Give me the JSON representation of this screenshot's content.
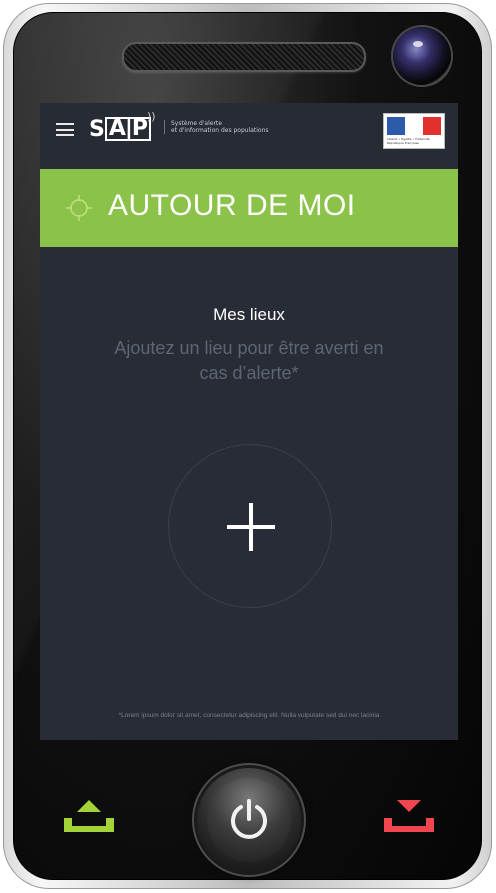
{
  "header": {
    "logo_text": "SAIP",
    "tagline_line1": "Système d'alerte",
    "tagline_line2": "et d'information des populations",
    "flag_caption": "Liberté • Égalité • Fraternité  République Française"
  },
  "banner": {
    "title": "AUTOUR DE MOI",
    "color": "#8bc34a"
  },
  "places": {
    "title": "Mes lieux",
    "hint": "Ajoutez un lieu pour être averti en cas d’alerte*"
  },
  "footnote": "*Lorem ipsum dolor sit amet, consectetur adipiscing elit. Nulla vulputate sed dui nec lacinia",
  "hardware": {
    "left_button_color": "#a3d239",
    "right_button_color": "#f0464f"
  }
}
